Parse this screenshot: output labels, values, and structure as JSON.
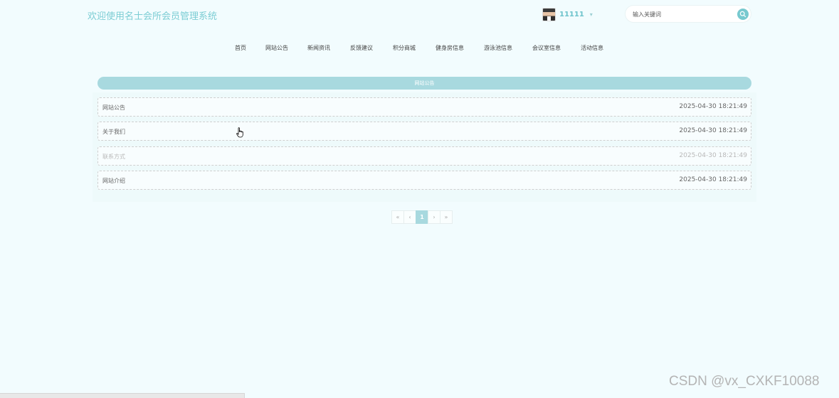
{
  "header": {
    "title": "欢迎使用名士会所会员管理系统",
    "username": "11111",
    "user_caret": "▾",
    "search_placeholder": "输入关键词"
  },
  "nav": {
    "items": [
      "首页",
      "网站公告",
      "新闻资讯",
      "反馈建议",
      "积分商城",
      "健身房信息",
      "游泳池信息",
      "会议室信息",
      "活动信息"
    ]
  },
  "section": {
    "banner_title": "网站公告"
  },
  "list": {
    "items": [
      {
        "title": "网站公告",
        "date": "2025-04-30 18:21:49"
      },
      {
        "title": "关于我们",
        "date": "2025-04-30 18:21:49"
      },
      {
        "title": "联系方式",
        "date": "2025-04-30 18:21:49"
      },
      {
        "title": "网站介绍",
        "date": "2025-04-30 18:21:49"
      }
    ]
  },
  "pagination": {
    "first": "«",
    "prev": "‹",
    "current": "1",
    "next": "›",
    "last": "»"
  },
  "watermark": "CSDN @vx_CXKF10088",
  "colors": {
    "background": "#f2fcfe",
    "accent": "#a8d9df",
    "title": "#7ccdd4"
  }
}
